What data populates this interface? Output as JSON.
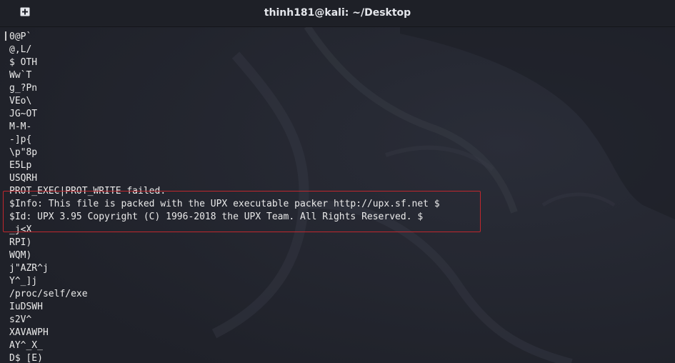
{
  "window": {
    "title": "thinh181@kali: ~/Desktop"
  },
  "icons": {
    "new_tab": "new-tab-icon"
  },
  "colors": {
    "background": "#23252e",
    "titlebar": "#1e2027",
    "text": "#eaeaea",
    "highlight": "#c0272d"
  },
  "terminal": {
    "lines": [
      "0@P`",
      "@,L/",
      "$ OTH",
      "Ww`T",
      "g_?Pn",
      "VEo\\",
      "JG~OT",
      "M-M-",
      "-]p{",
      "\\p\"8p",
      "E5Lp",
      "USQRH",
      "PROT_EXEC|PROT_WRITE failed.",
      "$Info: This file is packed with the UPX executable packer http://upx.sf.net $",
      "$Id: UPX 3.95 Copyright (C) 1996-2018 the UPX Team. All Rights Reserved. $",
      "_j<X",
      "RPI)",
      "WQM)",
      "j\"AZR^j",
      "Y^_]j",
      "/proc/self/exe",
      "IuDSWH",
      "s2V^",
      "XAVAWPH",
      "AY^_X_",
      "D$ [E)"
    ]
  }
}
